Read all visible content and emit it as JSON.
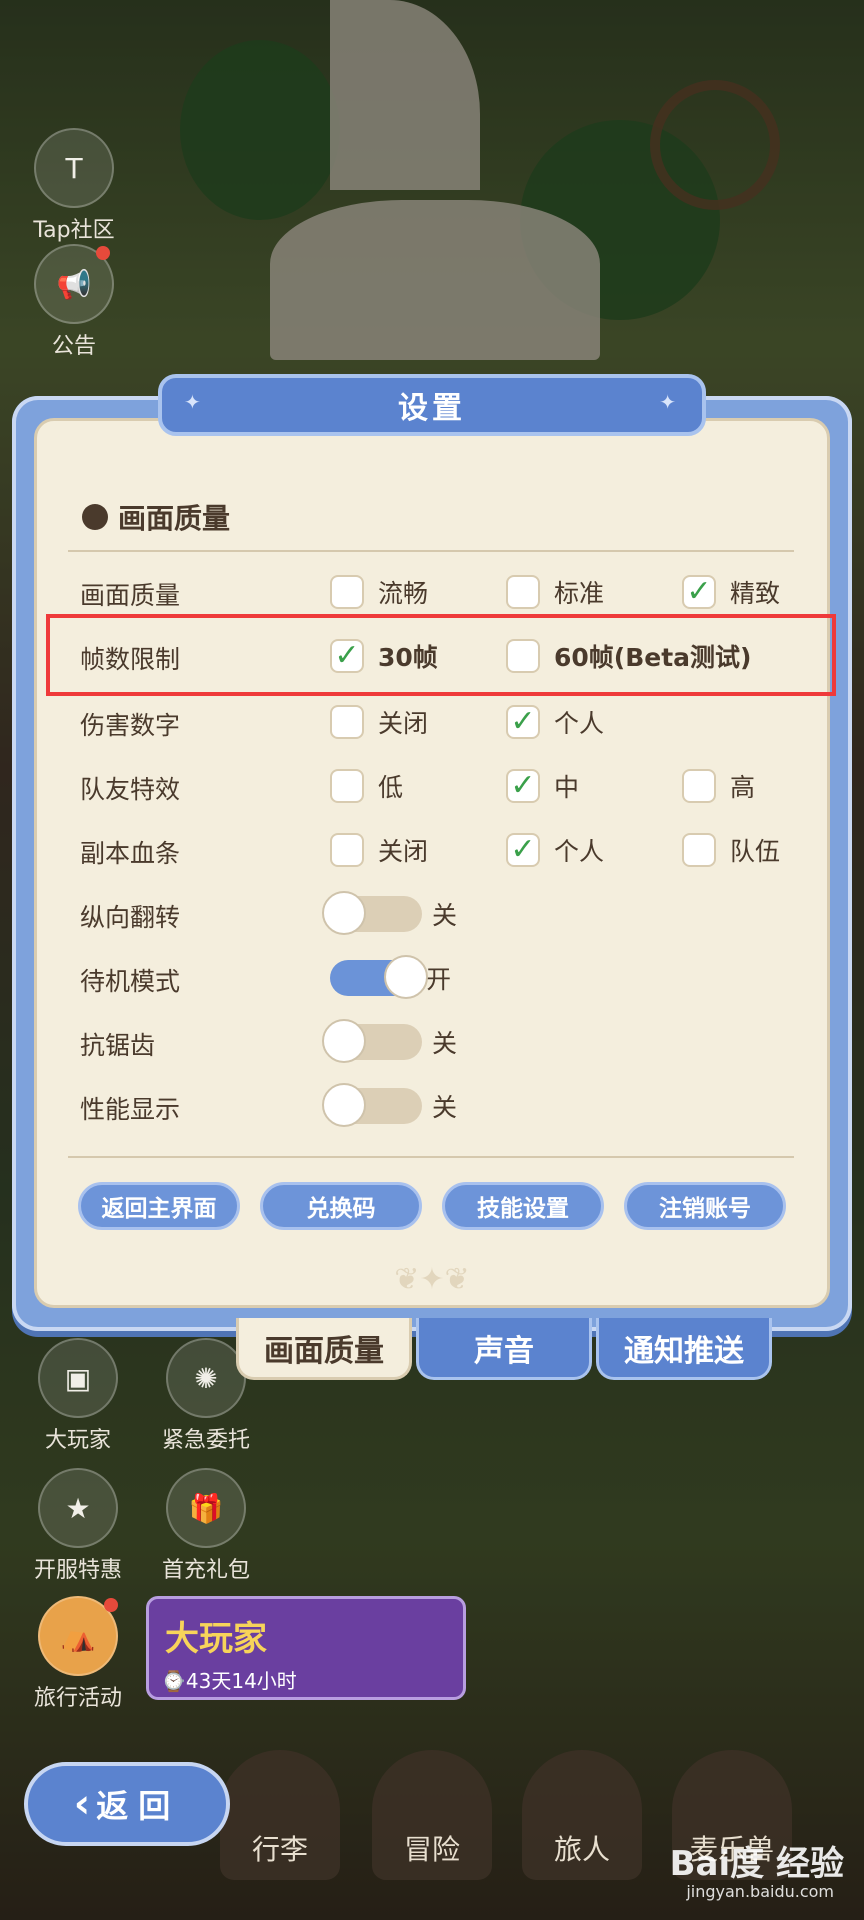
{
  "hud": {
    "tap_label": "Tap社区",
    "notice_label": "公告",
    "big_player_label": "大玩家",
    "urgent_label": "紧急委托",
    "server_deal_label": "开服特惠",
    "first_charge_label": "首充礼包",
    "travel_label": "旅行活动",
    "promo_title": "大玩家",
    "promo_timer": "⌚43天14小时"
  },
  "panel": {
    "title": "设置",
    "section_title": "画面质量",
    "rows": {
      "quality": {
        "label": "画面质量",
        "opt1": "流畅",
        "opt2": "标准",
        "opt3": "精致"
      },
      "fps": {
        "label": "帧数限制",
        "opt1": "30帧",
        "opt2": "60帧(Beta测试)"
      },
      "damage": {
        "label": "伤害数字",
        "opt1": "关闭",
        "opt2": "个人"
      },
      "teammate": {
        "label": "队友特效",
        "opt1": "低",
        "opt2": "中",
        "opt3": "高"
      },
      "hpbar": {
        "label": "副本血条",
        "opt1": "关闭",
        "opt2": "个人",
        "opt3": "队伍"
      },
      "flip": {
        "label": "纵向翻转",
        "state": "关"
      },
      "standby": {
        "label": "待机模式",
        "state": "开"
      },
      "antialias": {
        "label": "抗锯齿",
        "state": "关"
      },
      "perf": {
        "label": "性能显示",
        "state": "关"
      }
    },
    "buttons": {
      "home": "返回主界面",
      "redeem": "兑换码",
      "skill": "技能设置",
      "logout": "注销账号"
    },
    "check_mark": "✓"
  },
  "tabs": {
    "quality": "画面质量",
    "sound": "声音",
    "notify": "通知推送"
  },
  "bottom": {
    "back": "返回",
    "luggage": "行李",
    "adventure": "冒险",
    "traveler": "旅人",
    "pet": "麦乐兽"
  },
  "watermark": {
    "brand": "Bai度 经验",
    "url": "jingyan.baidu.com"
  }
}
